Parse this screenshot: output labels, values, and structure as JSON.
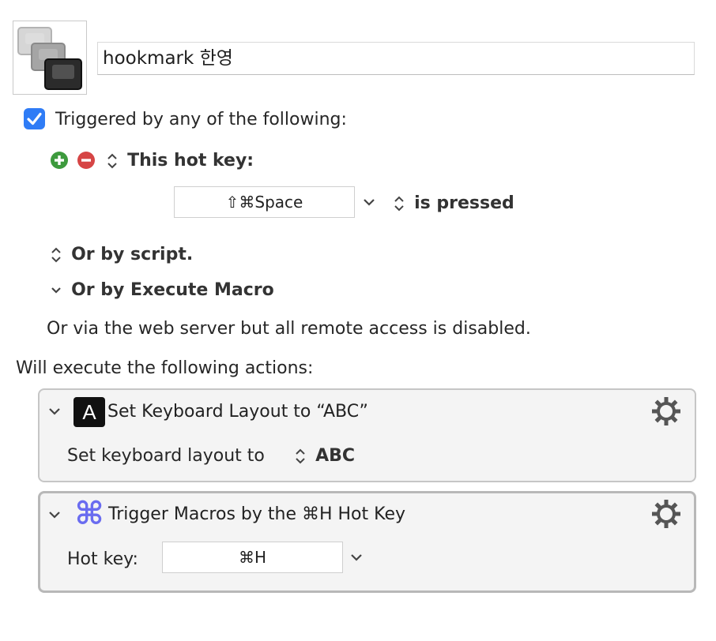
{
  "macro": {
    "name": "hookmark 한영"
  },
  "trigger": {
    "checkbox_label": "Triggered by any of the following:",
    "hotkey_label": "This hot key:",
    "hotkey_value": "⇧⌘Space",
    "pressed_label": "is pressed",
    "or_script": "Or by script.",
    "or_execute": "Or by Execute Macro",
    "web_server_note": "Or via the web server but all remote access is disabled."
  },
  "actions": {
    "header": "Will execute the following actions:",
    "items": [
      {
        "icon_letter": "A",
        "title": "Set Keyboard Layout to “ABC”",
        "field_label": "Set keyboard layout to",
        "field_value": "ABC"
      },
      {
        "icon_glyph": "⌘",
        "title": "Trigger Macros by the ⌘H Hot Key",
        "field_label": "Hot key:",
        "field_value": "⌘H"
      }
    ]
  },
  "colors": {
    "accent": "#2f7cf6",
    "add": "#3d9a3d",
    "remove": "#d64545",
    "command_icon": "#6a6cf0"
  },
  "icons": [
    "keyboard-stack-icon",
    "checkmark-icon",
    "add-icon",
    "remove-icon",
    "updown-arrows-icon",
    "chevron-down-icon",
    "gear-icon",
    "letter-a-icon",
    "command-icon"
  ]
}
